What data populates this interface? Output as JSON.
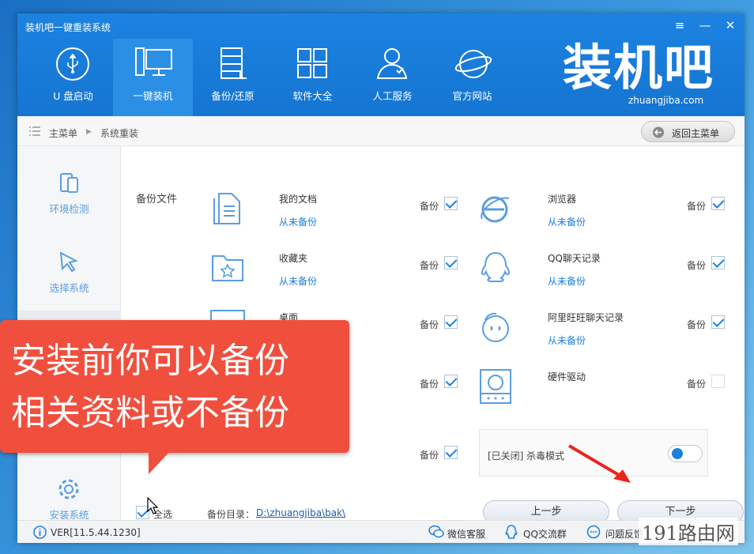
{
  "app": {
    "title": "装机吧一键重装系统",
    "brand": "装机吧",
    "brand_url": "zhuangjiba.com"
  },
  "window_controls": {
    "menu": "≡",
    "minimize": "—",
    "close": "✕"
  },
  "nav": [
    {
      "label": "U 盘启动",
      "icon": "usb-icon"
    },
    {
      "label": "一键装机",
      "icon": "monitor-icon"
    },
    {
      "label": "备份/还原",
      "icon": "backup-icon"
    },
    {
      "label": "软件大全",
      "icon": "apps-grid-icon"
    },
    {
      "label": "人工服务",
      "icon": "person-icon"
    },
    {
      "label": "官方网站",
      "icon": "globe-icon"
    }
  ],
  "breadcrumb": {
    "root": "主菜单",
    "current": "系统重装",
    "back_label": "返回主菜单"
  },
  "sidebar": [
    {
      "label": "环境检测",
      "icon": "device-icon"
    },
    {
      "label": "选择系统",
      "icon": "cursor-icon"
    },
    {
      "label": "",
      "icon": "box-icon"
    },
    {
      "label": "安装系统",
      "icon": "gear-icon"
    }
  ],
  "backup": {
    "section_label": "备份文件",
    "backup_word": "备份",
    "items_left": [
      {
        "name": "我的文档",
        "status": "从未备份",
        "checked": true
      },
      {
        "name": "收藏夹",
        "status": "从未备份",
        "checked": true
      },
      {
        "name": "桌面",
        "status": "",
        "checked": true
      },
      {
        "name": "",
        "status": "",
        "checked": true
      },
      {
        "name": "",
        "status": "",
        "checked": true
      }
    ],
    "items_right": [
      {
        "name": "浏览器",
        "status": "从未备份",
        "checked": true
      },
      {
        "name": "QQ聊天记录",
        "status": "从未备份",
        "checked": true
      },
      {
        "name": "阿里旺旺聊天记录",
        "status": "从未备份",
        "checked": true
      },
      {
        "name": "硬件驱动",
        "status": "",
        "checked": false
      }
    ],
    "antivirus": "[已关闭] 杀毒模式",
    "select_all": "全选",
    "dir_label": "备份目录：",
    "dir_path": "D:\\zhuangjiba\\bak\\",
    "prev": "上一步",
    "next": "下一步"
  },
  "footer": {
    "version": "VER[11.5.44.1230]",
    "wechat": "微信客服",
    "qq": "QQ交流群",
    "feedback": "问题反馈"
  },
  "callout": {
    "line1": "安装前你可以备份",
    "line2": "相关资料或不备份"
  },
  "watermark": "191路由网",
  "colors": {
    "header": "#1575d2",
    "accent": "#1d7fdc",
    "callout": "#f14f3e"
  }
}
